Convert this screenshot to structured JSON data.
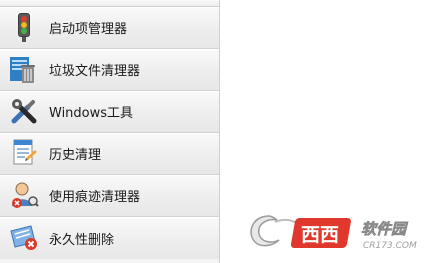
{
  "menu": {
    "items": [
      {
        "label": "启动项管理器",
        "icon": "traffic-light-icon"
      },
      {
        "label": "垃圾文件清理器",
        "icon": "trash-bin-icon"
      },
      {
        "label": "Windows工具",
        "icon": "tools-icon"
      },
      {
        "label": "历史清理",
        "icon": "history-document-icon"
      },
      {
        "label": "使用痕迹清理器",
        "icon": "user-trace-icon"
      },
      {
        "label": "永久性删除",
        "icon": "permanent-delete-icon"
      }
    ]
  },
  "watermark": {
    "brand": "西西",
    "brand_sub": "软件园",
    "site": "CR173.COM"
  },
  "colors": {
    "brand_red": "#e0382c",
    "label_text": "#1a1a1a"
  }
}
